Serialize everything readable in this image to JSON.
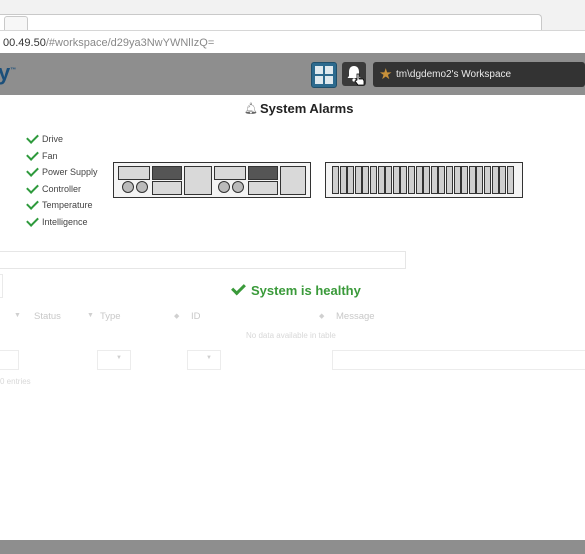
{
  "browser": {
    "url_host": "00.49.50",
    "url_path": "/#workspace/d29ya3NwYWNlIzQ="
  },
  "header": {
    "brand": "y",
    "workspace_label": "tm\\dgdemo2's Workspace"
  },
  "page": {
    "title": "System Alarms",
    "checks": [
      "Drive",
      "Fan",
      "Power Supply",
      "Controller",
      "Temperature",
      "Intelligence"
    ],
    "health_status": "System is healthy"
  },
  "table": {
    "columns": [
      "Status",
      "Type",
      "ID",
      "Message"
    ],
    "empty_text": "No data available in table",
    "entries_text": "0 entries"
  },
  "colors": {
    "ok_green": "#3a9a3a",
    "header_gray": "#8e8e8e",
    "star": "#c8913a"
  }
}
